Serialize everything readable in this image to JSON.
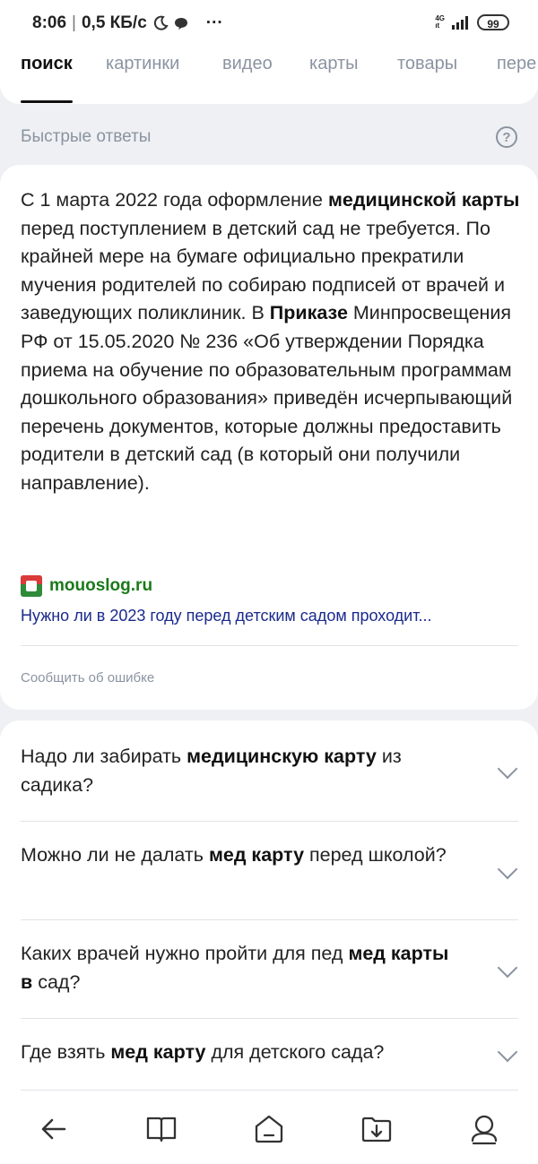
{
  "status_bar": {
    "time": "8:06",
    "speed": "0,5 КБ/с",
    "more": "···",
    "network_top": "4G",
    "network_bottom": "ıt",
    "battery": "99"
  },
  "tabs": [
    {
      "label": "поиск",
      "active": true
    },
    {
      "label": "картинки",
      "active": false
    },
    {
      "label": "видео",
      "active": false
    },
    {
      "label": "карты",
      "active": false
    },
    {
      "label": "товары",
      "active": false
    },
    {
      "label": "пере",
      "active": false
    }
  ],
  "quick_answers": {
    "title": "Быстрые ответы",
    "help_symbol": "?"
  },
  "answer": {
    "segments": [
      {
        "text": "С 1 марта 2022 года оформление ",
        "bold": false
      },
      {
        "text": "медицинской карты",
        "bold": true
      },
      {
        "text": " перед поступлением в детский сад не требуется. По крайней мере на бумаге официально прекратили мучения родителей по собираю подписей от врачей и заведующих поликлиник. В ",
        "bold": false
      },
      {
        "text": "Приказе",
        "bold": true
      },
      {
        "text": " Минпросвещения РФ от 15.05.2020 № 236 «Об утверждении Порядка приема на обучение по образовательным программам дошкольного образования» приведён исчерпывающий перечень документов, которые должны предоставить родители в детский сад (в который они получили направление).",
        "bold": false
      }
    ],
    "source_name": "mouoslog.ru",
    "source_link": "Нужно ли в 2023 году перед детским садом проходит...",
    "report": "Сообщить об ошибке"
  },
  "faq": [
    {
      "segments": [
        {
          "text": "Надо ли забирать ",
          "bold": false
        },
        {
          "text": "медицинскую карту",
          "bold": true
        },
        {
          "text": " из садика?",
          "bold": false
        }
      ]
    },
    {
      "segments": [
        {
          "text": "Можно ли не далать ",
          "bold": false
        },
        {
          "text": "мед карту",
          "bold": true
        },
        {
          "text": " перед школой?",
          "bold": false
        }
      ]
    },
    {
      "segments": [
        {
          "text": "Каких врачей нужно пройти для пед ",
          "bold": false
        },
        {
          "text": "мед карты в",
          "bold": true
        },
        {
          "text": " сад?",
          "bold": false
        }
      ]
    },
    {
      "segments": [
        {
          "text": "Где взять ",
          "bold": false
        },
        {
          "text": "мед карту",
          "bold": true
        },
        {
          "text": " для детского сада?",
          "bold": false
        }
      ]
    }
  ],
  "bottom_nav": [
    {
      "icon": "back-arrow-icon"
    },
    {
      "icon": "book-icon"
    },
    {
      "icon": "home-icon"
    },
    {
      "icon": "download-icon"
    },
    {
      "icon": "profile-icon"
    }
  ]
}
